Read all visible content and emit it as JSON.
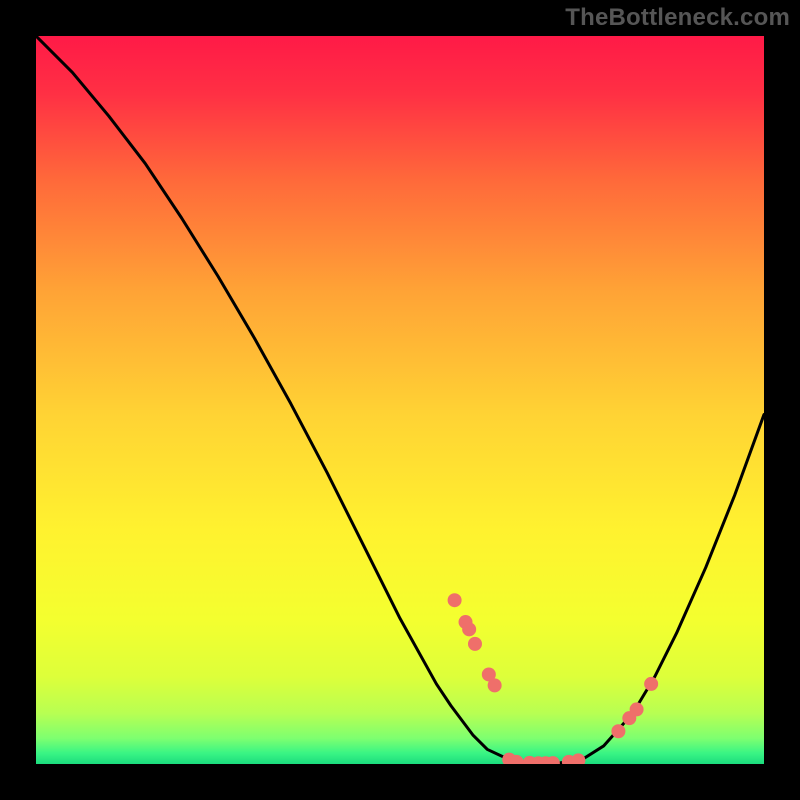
{
  "watermark": "TheBottleneck.com",
  "chart_data": {
    "type": "line",
    "title": "",
    "xlabel": "",
    "ylabel": "",
    "xlim": [
      0,
      100
    ],
    "ylim": [
      0,
      100
    ],
    "grid": false,
    "legend": false,
    "background_gradient": [
      "#ff1a47",
      "#ff5a3c",
      "#ffa436",
      "#ffe236",
      "#ecff36",
      "#b6ff4a",
      "#5aff7a",
      "#22e07e"
    ],
    "series": [
      {
        "name": "curve",
        "type": "line",
        "x": [
          0,
          5,
          10,
          15,
          20,
          25,
          30,
          35,
          40,
          45,
          50,
          55,
          57,
          60,
          62,
          65,
          68,
          70,
          72,
          75,
          78,
          82,
          85,
          88,
          92,
          96,
          100
        ],
        "y": [
          100,
          95,
          89,
          82.5,
          75,
          67,
          58.5,
          49.5,
          40,
          30,
          20,
          11,
          8,
          4,
          2,
          0.6,
          0.15,
          0.1,
          0.15,
          0.6,
          2.5,
          7,
          12,
          18,
          27,
          37,
          48
        ]
      },
      {
        "name": "markers",
        "type": "scatter",
        "color": "#ef6f6a",
        "x": [
          57.5,
          59.0,
          59.5,
          60.3,
          62.2,
          63.0,
          65.0,
          66.0,
          67.8,
          69.0,
          70.0,
          71.0,
          73.2,
          74.5,
          80.0,
          81.5,
          82.5,
          84.5
        ],
        "y": [
          22.5,
          19.5,
          18.5,
          16.5,
          12.3,
          10.8,
          0.6,
          0.3,
          0.15,
          0.1,
          0.1,
          0.12,
          0.3,
          0.5,
          4.5,
          6.3,
          7.5,
          11.0
        ]
      }
    ]
  }
}
